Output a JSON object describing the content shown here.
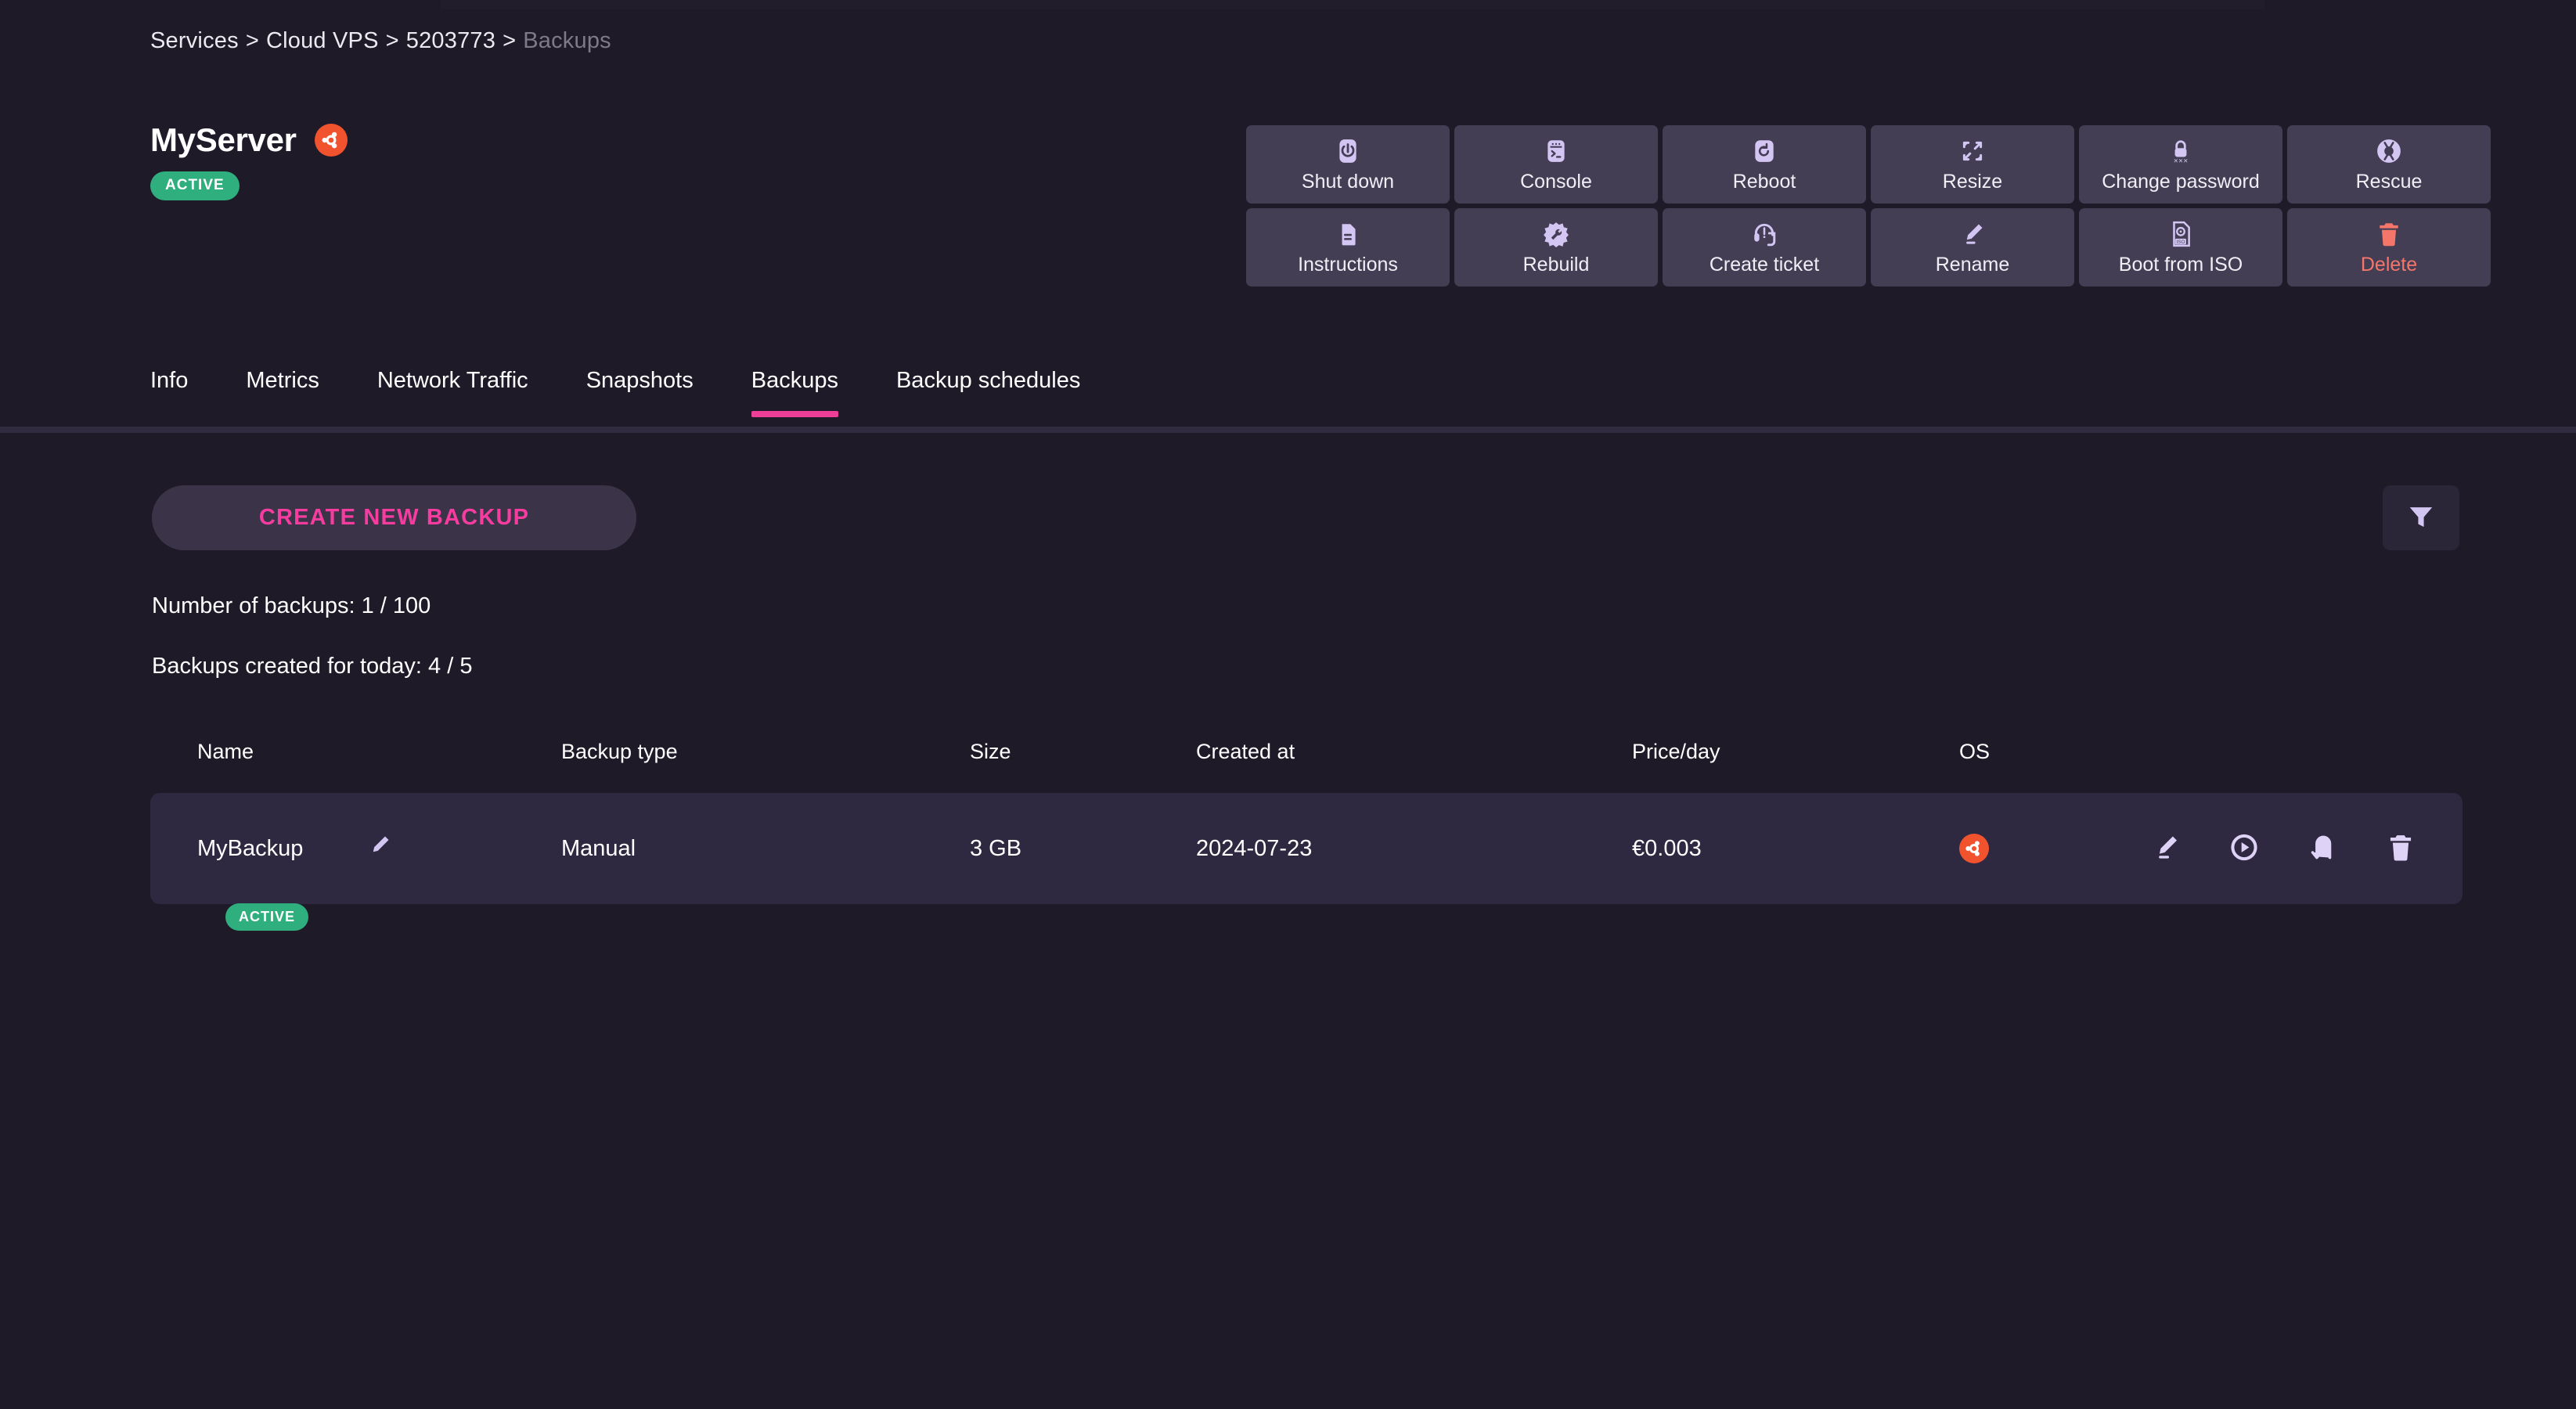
{
  "breadcrumb": {
    "items": [
      {
        "label": "Services",
        "current": false
      },
      {
        "label": "Cloud VPS",
        "current": false
      },
      {
        "label": "5203773",
        "current": false
      },
      {
        "label": "Backups",
        "current": true
      }
    ],
    "separator": ">"
  },
  "server": {
    "name": "MyServer",
    "os_icon": "ubuntu-icon",
    "status_badge": "ACTIVE",
    "status_color": "#2fae7e"
  },
  "actions": [
    {
      "label": "Shut down",
      "icon": "power-icon",
      "danger": false
    },
    {
      "label": "Console",
      "icon": "console-icon",
      "danger": false
    },
    {
      "label": "Reboot",
      "icon": "reboot-icon",
      "danger": false
    },
    {
      "label": "Resize",
      "icon": "resize-icon",
      "danger": false
    },
    {
      "label": "Change password",
      "icon": "lock-password-icon",
      "danger": false
    },
    {
      "label": "Rescue",
      "icon": "lifebuoy-icon",
      "danger": false
    },
    {
      "label": "Instructions",
      "icon": "document-icon",
      "danger": false
    },
    {
      "label": "Rebuild",
      "icon": "wrench-icon",
      "danger": false
    },
    {
      "label": "Create ticket",
      "icon": "headset-icon",
      "danger": false
    },
    {
      "label": "Rename",
      "icon": "pencil-icon",
      "danger": false
    },
    {
      "label": "Boot from ISO",
      "icon": "iso-file-icon",
      "danger": false
    },
    {
      "label": "Delete",
      "icon": "trash-icon",
      "danger": true
    }
  ],
  "tabs": [
    {
      "label": "Info",
      "active": false
    },
    {
      "label": "Metrics",
      "active": false
    },
    {
      "label": "Network Traffic",
      "active": false
    },
    {
      "label": "Snapshots",
      "active": false
    },
    {
      "label": "Backups",
      "active": true
    },
    {
      "label": "Backup schedules",
      "active": false
    }
  ],
  "toolbar": {
    "create_label": "CREATE NEW BACKUP",
    "filter_icon": "filter-icon",
    "accent_color": "#f73ca0"
  },
  "stats": {
    "backups_count": "Number of backups: 1 / 100",
    "backups_today": "Backups created for today: 4 / 5"
  },
  "table": {
    "headers": [
      "Name",
      "Backup type",
      "Size",
      "Created at",
      "Price/day",
      "OS"
    ],
    "rows": [
      {
        "name": "MyBackup",
        "status_badge": "ACTIVE",
        "backup_type": "Manual",
        "size": "3 GB",
        "created_at": "2024-07-23",
        "price_per_day": "€0.003",
        "os_icon": "ubuntu-icon",
        "actions": [
          "pencil-icon",
          "play-circle-icon",
          "restore-arrow-icon",
          "trash-icon"
        ]
      }
    ]
  }
}
